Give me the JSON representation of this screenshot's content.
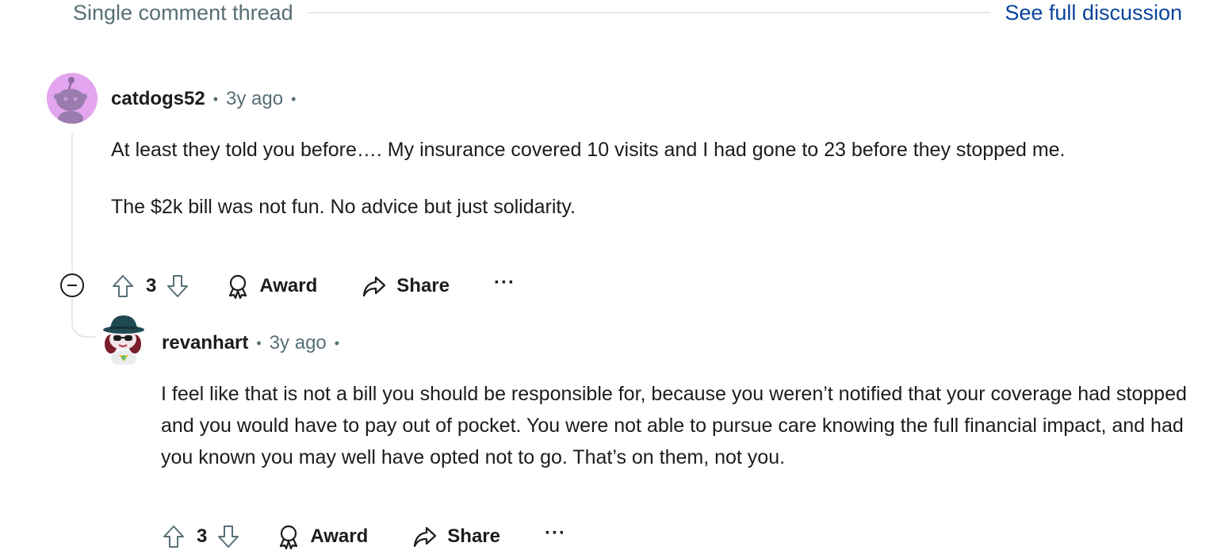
{
  "thread_header": {
    "title": "Single comment thread",
    "link_label": "See full discussion"
  },
  "colors": {
    "secondary_text": "#576f76",
    "link": "#0a449b",
    "thread_line": "#e4e9eb",
    "avatar_bg": "#e3a4f0"
  },
  "comments": [
    {
      "author": "catdogs52",
      "separator": "•",
      "time": "3y ago",
      "paragraphs": [
        "At least they told you before…. My insurance covered 10 visits and I had gone to 23 before they stopped me.",
        "The $2k bill was not fun. No advice but just solidarity."
      ],
      "score": "3",
      "award_label": "Award",
      "share_label": "Share",
      "more_label": "···",
      "avatar_icon": "snoo-avatar-icon"
    },
    {
      "author": "revanhart",
      "separator": "•",
      "time": "3y ago",
      "paragraphs": [
        "I feel like that is not a bill you should be responsible for, because you weren’t notified that your coverage had stopped and you would have to pay out of pocket. You were not able to pursue care knowing the full financial impact, and had you known you may well have opted not to go. That’s on them, not you."
      ],
      "score": "3",
      "award_label": "Award",
      "share_label": "Share",
      "more_label": "···",
      "avatar_icon": "custom-snoo-avatar-icon"
    }
  ]
}
